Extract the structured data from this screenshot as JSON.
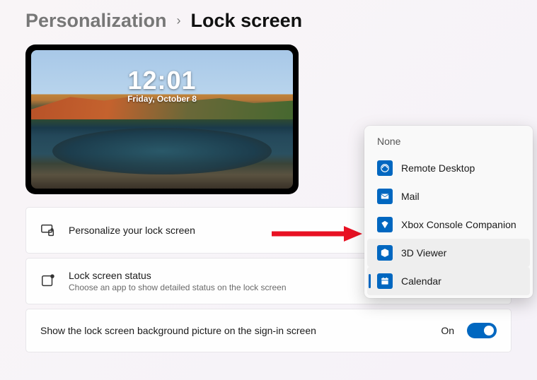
{
  "breadcrumb": {
    "parent": "Personalization",
    "current": "Lock screen"
  },
  "preview": {
    "time": "12:01",
    "date": "Friday, October 8"
  },
  "cards": {
    "personalize": {
      "title": "Personalize your lock screen"
    },
    "status": {
      "title": "Lock screen status",
      "subtitle": "Choose an app to show detailed status on the lock screen"
    },
    "bgpicture": {
      "title": "Show the lock screen background picture on the sign-in screen",
      "toggle_state": "On"
    }
  },
  "dropdown": {
    "none": "None",
    "items": [
      {
        "label": "Remote Desktop"
      },
      {
        "label": "Mail"
      },
      {
        "label": "Xbox Console Companion"
      },
      {
        "label": "3D Viewer"
      },
      {
        "label": "Calendar"
      }
    ],
    "hover_index": 3,
    "selected_index": 4
  }
}
